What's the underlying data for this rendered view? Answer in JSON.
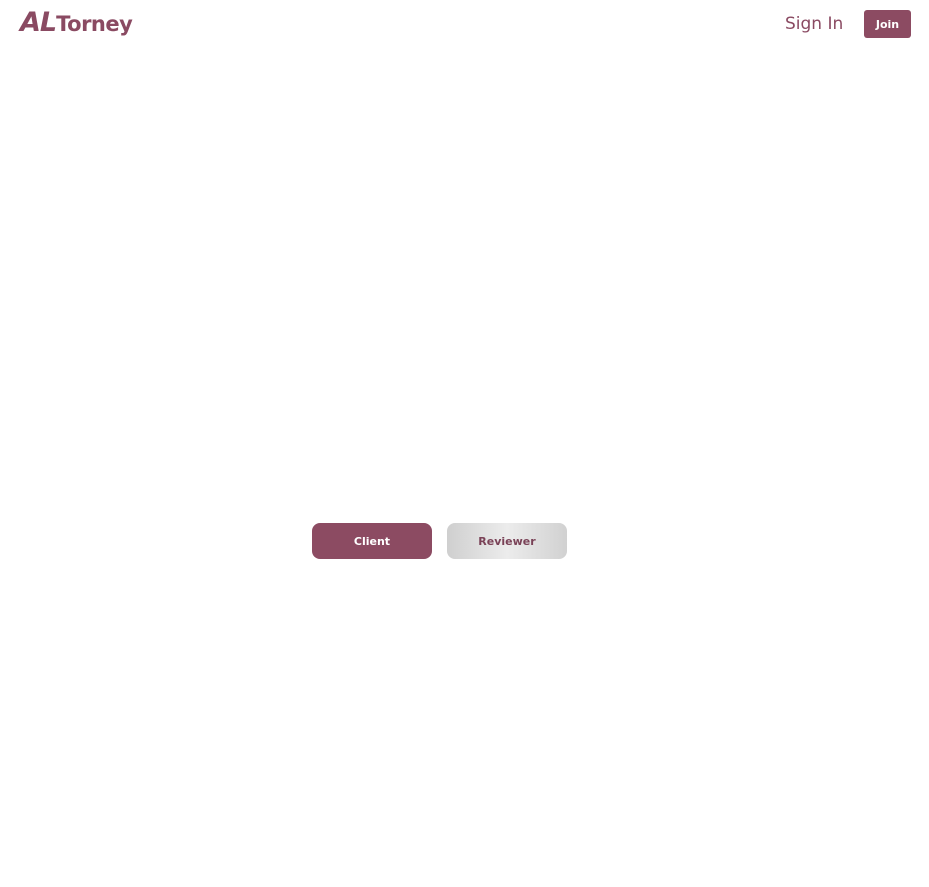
{
  "brand": {
    "logo_part1": "AL",
    "logo_part2": "Torney",
    "color": "#8c4b62"
  },
  "header": {
    "sign_in_label": "Sign In",
    "join_label": "Join"
  },
  "role_selector": {
    "client_label": "Client",
    "reviewer_label": "Reviewer",
    "selected": "Client",
    "selected_color": "#8c4b62",
    "unselected_color": "#dcdcdc"
  }
}
